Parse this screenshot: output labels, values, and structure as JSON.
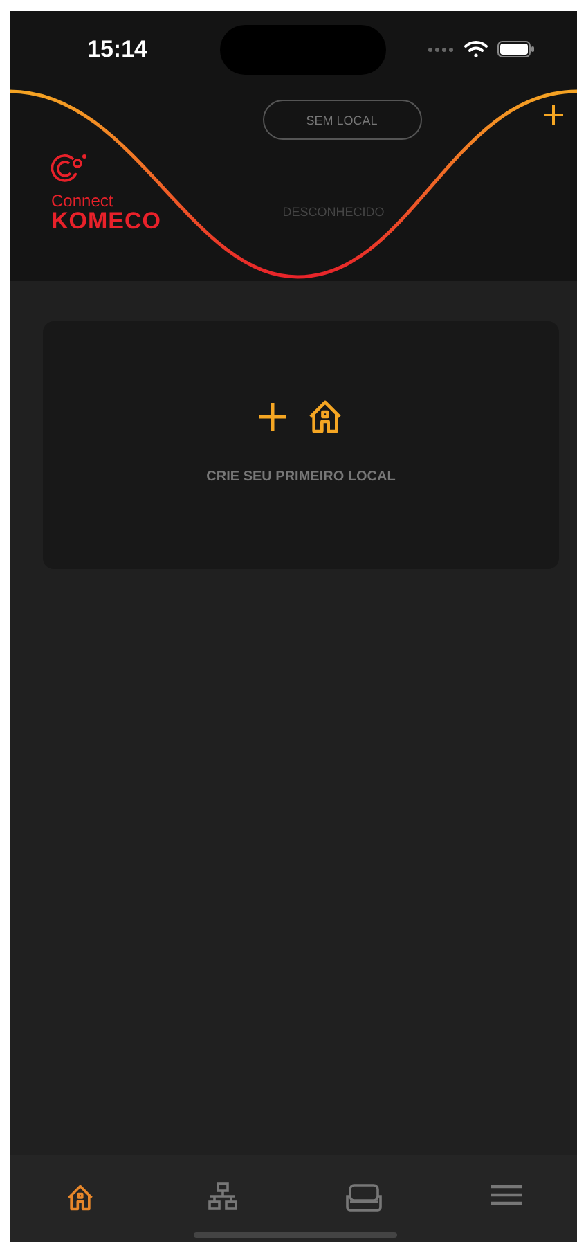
{
  "status_bar": {
    "time": "15:14"
  },
  "header": {
    "location_button": "SEM LOCAL",
    "status": "DESCONHECIDO",
    "logo": {
      "line_1": "Connect",
      "line_2": "KOMECO"
    }
  },
  "empty_card": {
    "message": "CRIE SEU PRIMEIRO LOCAL"
  },
  "nav": [
    {
      "kind": "home",
      "selected": true
    },
    {
      "kind": "network",
      "selected": false
    },
    {
      "kind": "sofa",
      "selected": false
    },
    {
      "kind": "menu",
      "selected": false
    }
  ]
}
